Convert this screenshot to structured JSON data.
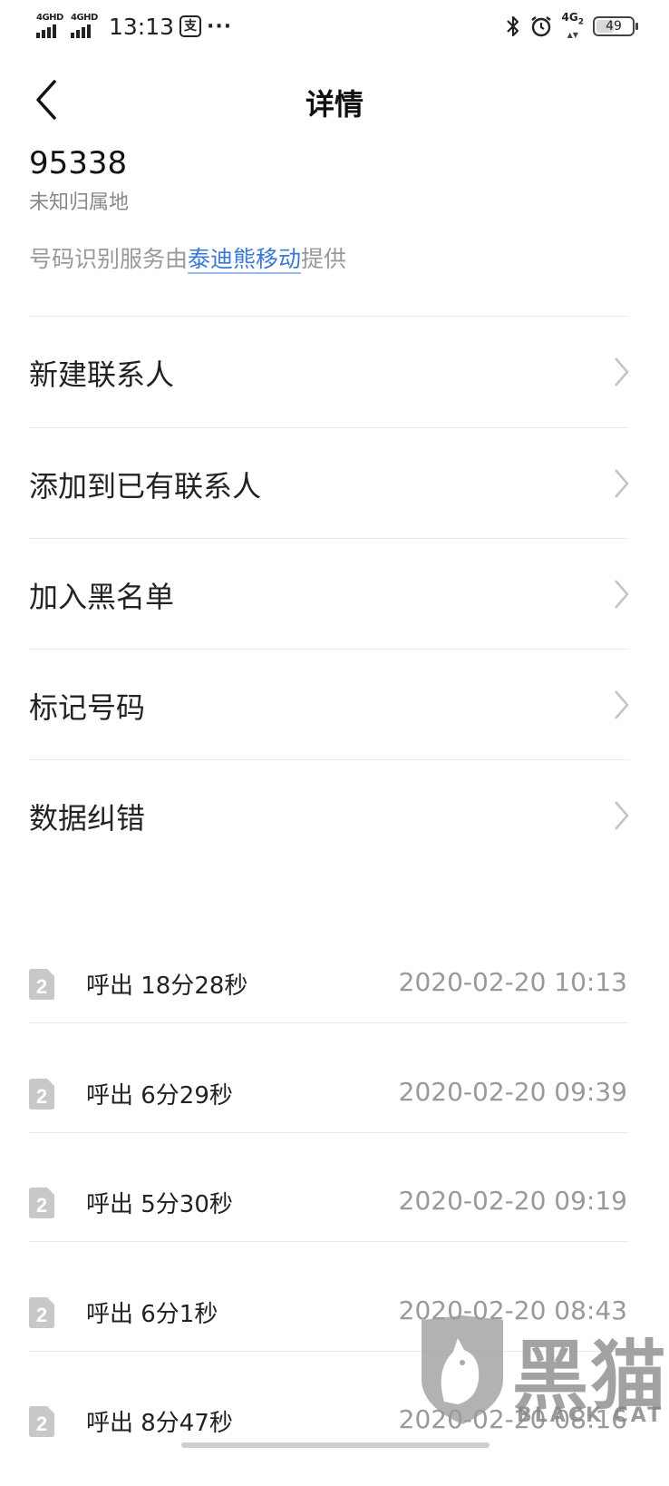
{
  "status_bar": {
    "sim1_label": "4GHD",
    "sim2_label": "4GHD",
    "time": "13:13",
    "app_icon_label": "支",
    "overflow": "···",
    "network": "4G",
    "network_sub": "2",
    "battery": "49"
  },
  "header": {
    "title": "详情"
  },
  "info": {
    "number": "95338",
    "location": "未知归属地",
    "provider_prefix": "号码识别服务由",
    "provider_name": "泰迪熊移动",
    "provider_suffix": "提供"
  },
  "menu": [
    {
      "label": "新建联系人"
    },
    {
      "label": "添加到已有联系人"
    },
    {
      "label": "加入黑名单"
    },
    {
      "label": "标记号码"
    },
    {
      "label": "数据纠错"
    }
  ],
  "calls": [
    {
      "sim": "2",
      "desc": "呼出 18分28秒",
      "time": "2020-02-20 10:13"
    },
    {
      "sim": "2",
      "desc": "呼出 6分29秒",
      "time": "2020-02-20 09:39"
    },
    {
      "sim": "2",
      "desc": "呼出 5分30秒",
      "time": "2020-02-20 09:19"
    },
    {
      "sim": "2",
      "desc": "呼出 6分1秒",
      "time": "2020-02-20 08:43"
    },
    {
      "sim": "2",
      "desc": "呼出 8分47秒",
      "time": "2020-02-20 08:16"
    }
  ],
  "watermark": {
    "cn": "黑猫",
    "en": "BLACK CAT"
  }
}
